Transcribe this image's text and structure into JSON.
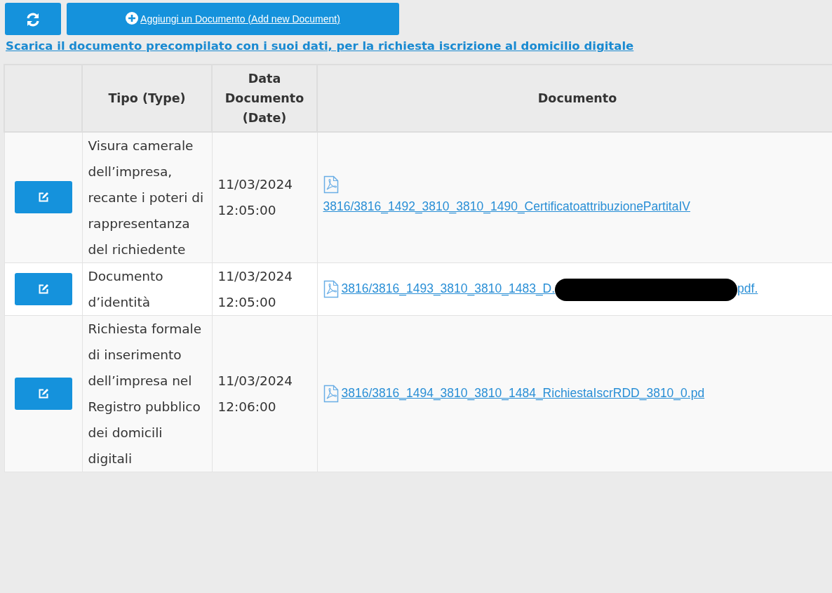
{
  "toolbar": {
    "add_button": {
      "label": "Aggiungi un Documento (Add new Document)"
    }
  },
  "download_link": "Scarica il documento precompilato con i suoi dati, per la richiesta iscrizione al domicilio digitale",
  "table": {
    "columns": [
      "",
      "Tipo (Type)",
      "Data Documento (Date)",
      "Documento"
    ],
    "rows": [
      {
        "type": "Visura camerale dell’impresa, recante i poteri di rappresentanza del richiedente",
        "date": "11/03/2024 12:05:00",
        "file": "3816/3816_1492_3810_3810_1490_CertificatoattribuzionePartitaIV",
        "icon_above": true,
        "redacted": false
      },
      {
        "type": "Documento d’identità",
        "date": "11/03/2024 12:05:00",
        "file": "3816/3816_1493_3810_3810_1483_D.",
        "file_end": "pdf.",
        "icon_above": false,
        "redacted": true
      },
      {
        "type": "Richiesta formale di inserimento dell’impresa nel Registro pubblico dei domicili digitali",
        "date": "11/03/2024 12:06:00",
        "file": "3816/3816_1494_3810_3810_1484_RichiestaIscrRDD_3810_0.pd",
        "icon_above": false,
        "redacted": false
      }
    ]
  }
}
